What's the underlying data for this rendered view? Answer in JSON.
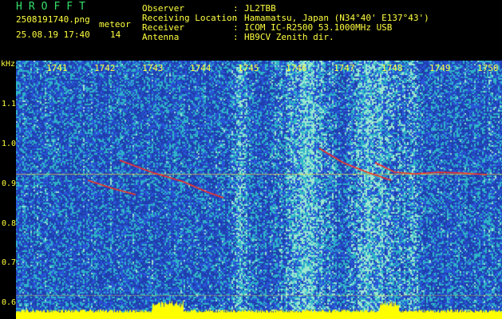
{
  "header": {
    "brand": "HROFFT",
    "filename": "2508191740.png",
    "datetime": "25.08.19 17:40",
    "mode_label": "meteor",
    "count": "14"
  },
  "station": [
    {
      "label": "Observer",
      "value": "JL2TBB"
    },
    {
      "label": "Receiving Location",
      "value": "Hamamatsu, Japan (N34°40' E137°43')"
    },
    {
      "label": "Receiver",
      "value": "ICOM IC-R2500 53.1000MHz USB"
    },
    {
      "label": "Antenna",
      "value": "HB9CV Zenith dir."
    }
  ],
  "spectrogram": {
    "freq_unit": "kHz",
    "time_labels": [
      "1741",
      "1742",
      "1743",
      "1744",
      "1745",
      "1746",
      "1747",
      "1748",
      "1749",
      "1750"
    ],
    "freq_labels": [
      "1.1",
      "1.0",
      "0.9",
      "0.8",
      "0.7",
      "0.6"
    ],
    "colors": {
      "background": "#1f3fae",
      "noise_low": "#2a56d8",
      "noise_mid": "#2fb4c8",
      "noise_high": "#9be8d0",
      "echo": "#ff3020",
      "carrier": "#f0d040",
      "spectrum_trace": "#ffff00"
    }
  }
}
